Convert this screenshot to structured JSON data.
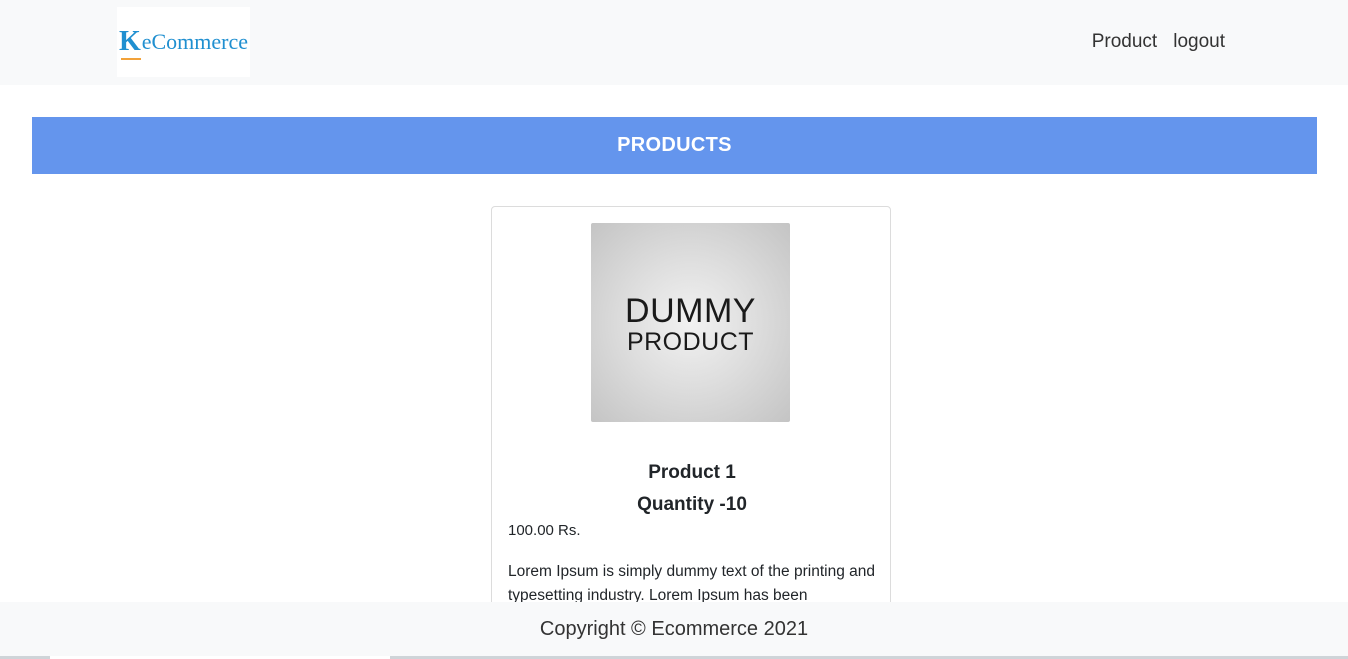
{
  "navbar": {
    "logo_letter": "K",
    "logo_text": "eCommerce",
    "links": [
      "Product",
      "logout"
    ]
  },
  "banner": {
    "title": "PRODUCTS",
    "color": "#6495ed"
  },
  "product_card": {
    "image": {
      "line1": "DUMMY",
      "line2": "PRODUCT"
    },
    "name": "Product 1",
    "quantity": "Quantity -10",
    "price": "100.00 Rs.",
    "description": "Lorem Ipsum is simply dummy text of the printing and typesetting industry. Lorem Ipsum has been"
  },
  "footer": {
    "text": "Copyright © Ecommerce 2021"
  }
}
